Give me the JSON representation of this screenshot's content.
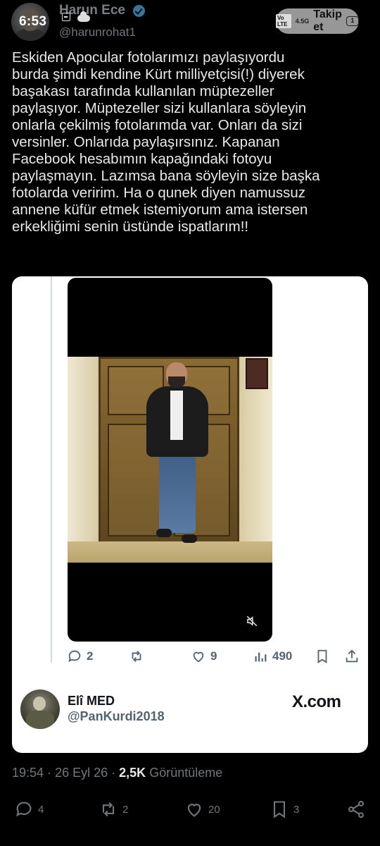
{
  "status_bar": {
    "time": "6:53",
    "network": "4.5G",
    "volte": "Vo LTE",
    "battery": "1"
  },
  "author": {
    "name": "Harun Ece",
    "handle": "@harunrohat1",
    "follow_label": "Takip et"
  },
  "tweet": {
    "text": "Eskiden Apocular fotolarımızı paylaşıyordu\nburda şimdi kendine Kürt milliyetçisi(!) diyerek\nbaşakası tarafında  kullanılan müptezeller\npaylaşıyor. Müptezeller sizi kullanlara söyleyin\nonlarla çekilmiş fotolarımda var. Onları da sizi\nversinler. Onlarıda paylaşırsınız. Kapanan\nFacebook hesabımın kapağındaki fotoyu\npaylaşmayın. Lazımsa bana söyleyin size başka\nfotolarda veririm. Ha o qunek diyen namussuz\nannene küfür etmek istemiyorum ama istersen\nerkekliğimi senin üstünde ispatlarım!!"
  },
  "quoted": {
    "replies": "2",
    "likes": "9",
    "views": "490",
    "author_name": "Elî MED",
    "author_handle": "@PanKurdi2018",
    "source": "X.com"
  },
  "meta": {
    "time": "19:54",
    "date": "26 Eyl 26",
    "views_count": "2,5K",
    "views_label": "Görüntüleme"
  },
  "actions": {
    "replies": "4",
    "reposts": "2",
    "likes": "20",
    "bookmarks": "3"
  },
  "colors": {
    "background": "#000000",
    "text": "#e7e9ea",
    "muted": "#71767b",
    "card": "#ffffff"
  }
}
